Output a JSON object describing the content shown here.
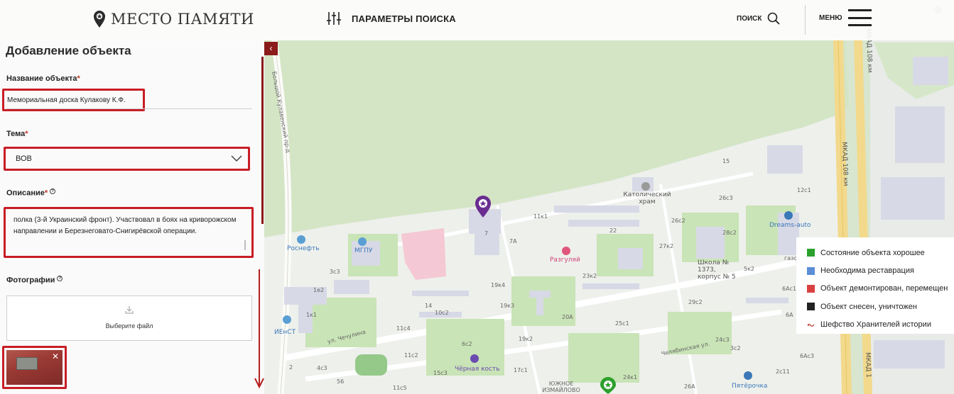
{
  "header": {
    "logo_text": "МЕСТО ПАМЯТИ",
    "search_params_label": "ПАРАМЕТРЫ ПОИСКА",
    "search_label": "ПОИСК",
    "menu_label": "МЕНЮ"
  },
  "panel": {
    "title": "Добавление объекта",
    "name_label": "Название объекта",
    "name_value": "Мемориальная доска Кулакову К.Ф.",
    "theme_label": "Тема",
    "theme_value": "ВОВ",
    "description_label": "Описание",
    "description_value": "полка (3-й Украинский фронт). Участвовал в боях на криворожском направлении и Березнеговато-Снигирёвской операции.",
    "photos_label": "Фотографии",
    "upload_label": "Выберите файл",
    "required_mark": "*",
    "help_mark": "?",
    "collapse_glyph": "‹",
    "close_glyph": "✕"
  },
  "legend": {
    "items": [
      {
        "label": "Состояние объекта хорошее",
        "color": "#2ca02c"
      },
      {
        "label": "Необходима реставрация",
        "color": "#5b8ed6"
      },
      {
        "label": "Объект демонтирован, перемещен",
        "color": "#d94040"
      },
      {
        "label": "Объект снесен, уничтожен",
        "color": "#222222"
      },
      {
        "label": "Шефство Хранителей истории",
        "color": "#c0392b",
        "icon": "guardian-icon"
      }
    ]
  },
  "map": {
    "labels": {
      "street_kulakovsky": "Большой Кулавенский пр-д",
      "mkad_1": "МКАД 108 км",
      "mkad_2": "МКАД 108 км",
      "mkad_3": "МКАД 1",
      "chechulina": "ул. Чечулина",
      "chelyabinskaya": "Челябинская ул.",
      "catholic": "Католический храм",
      "razgulyay": "Разгуляй",
      "school": "Школа № 1373, корпус № 5",
      "dreams": "Dreams-auto",
      "rosneft": "Роснефть",
      "mgpu": "МГПУ",
      "ienst": "ИЕнСТ",
      "chernaya": "Чёрная кость",
      "izmaylovo": "ЮЖНОЕ ИЗМАЙЛОВО",
      "pyaterochka": "Пятёрочка",
      "gazo": "газо",
      "n15": "15",
      "n26c3": "26с3",
      "n12c1": "12с1",
      "n11k1": "11к1",
      "n22": "22",
      "n26c2": "26с2",
      "n28c2": "28с2",
      "n7": "7",
      "n7a": "7А",
      "n27k2": "27к2",
      "n5k2": "5к2",
      "n3c3": "3с3",
      "n1e2": "1е2",
      "n1k1": "1к1",
      "n10c2": "10с2",
      "n14": "14",
      "n19k4": "19к4",
      "n19k3": "19к3",
      "n23k2": "23к2",
      "n20a": "20А",
      "n25c1": "25с1",
      "n29c2": "29с2",
      "n6ac1": "6Ас1",
      "n6a": "6А",
      "n11c4": "11с4",
      "n19k2": "19к2",
      "n6c2": "6с2",
      "n11c2": "11с2",
      "n15c3": "15с3",
      "n17c1": "17с1",
      "n24k1": "24к1",
      "n4c3": "4с3",
      "n11c5": "11с5",
      "n24c3": "24с3",
      "n3c2": "3с2",
      "n26a": "26А",
      "n2c11": "2с11",
      "n6ac3": "6Ас3",
      "n2": "2",
      "n56": "56"
    }
  }
}
